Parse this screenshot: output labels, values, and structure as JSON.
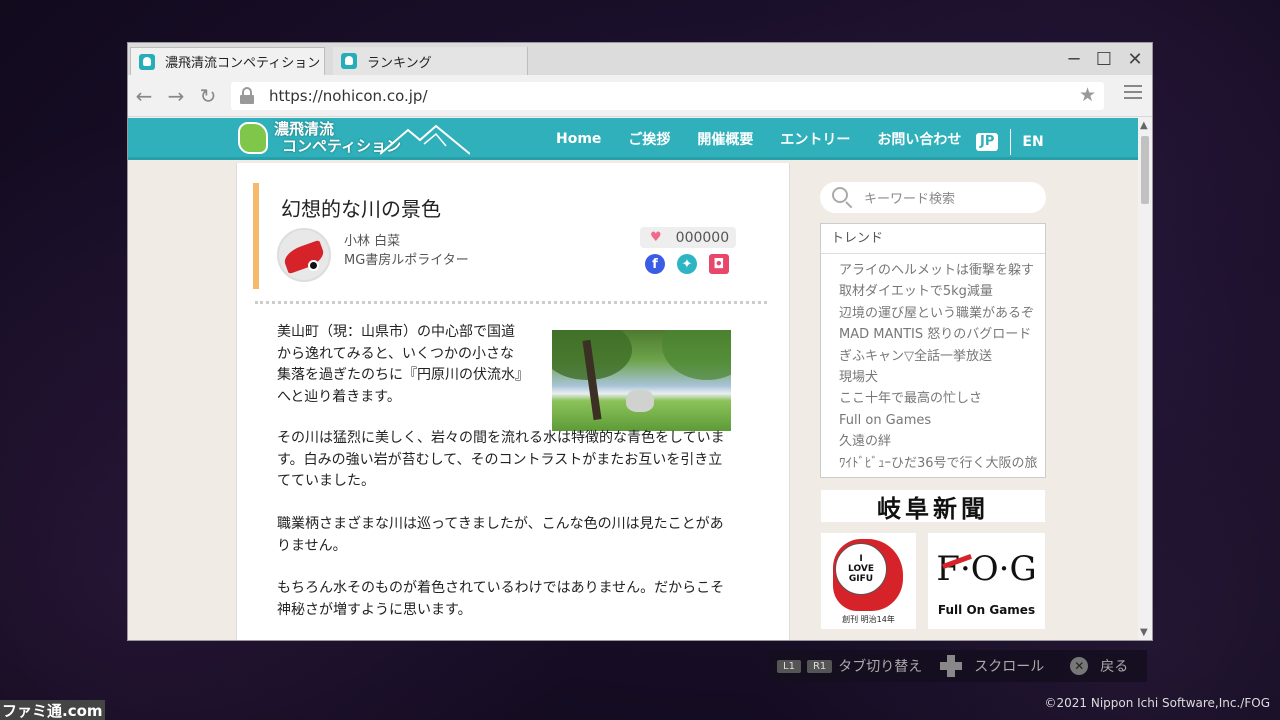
{
  "browser": {
    "tabs": [
      {
        "label": "濃飛清流コンペティション",
        "active": true
      },
      {
        "label": "ランキング",
        "active": false
      }
    ],
    "window_controls": {
      "minimize": "─",
      "maximize": "☐",
      "close": "✕"
    },
    "url": "https://nohicon.co.jp/",
    "nav": {
      "back": "←",
      "forward": "→",
      "reload": "↻"
    }
  },
  "site": {
    "logo_line1": "濃飛清流",
    "logo_line2": "コンペティション",
    "nav": [
      "Home",
      "ご挨拶",
      "開催概要",
      "エントリー",
      "お問い合わせ"
    ],
    "lang_jp": "JP",
    "lang_en": "EN",
    "accent_color": "#2fb0ba"
  },
  "article": {
    "title": "幻想的な川の景色",
    "author_name": "小林 白菜",
    "author_role": "MG書房ルポライター",
    "likes": "000000",
    "paragraphs": [
      "美山町（現：山県市）の中心部で国道から逸れてみると、いくつかの小さな集落を過ぎたのちに『円原川の伏流水』へと辿り着きます。",
      "その川は猛烈に美しく、岩々の間を流れる水は特徴的な青色をしています。白みの強い岩が苔むして、そのコントラストがまたお互いを引き立てていました。",
      "職業柄さまざまな川は巡ってきましたが、こんな色の川は見たことがありません。",
      "もちろん水そのものが着色されているわけではありません。だからこそ神秘さが増すように思います。"
    ]
  },
  "sidebar": {
    "search_placeholder": "キーワード検索",
    "trend_title": "トレンド",
    "trends": [
      "アライのヘルメットは衝撃を躱す",
      "取材ダイエットで5kg減量",
      "辺境の運び屋という職業があるぞ",
      "MAD MANTIS 怒りのバグロード",
      "ぎふキャン▽全話一挙放送",
      "現場犬",
      "ここ十年で最高の忙しさ",
      "Full on Games",
      "久遠の絆",
      "ﾜｲﾄﾞﾋﾞｭｰひだ36号で行く大阪の旅"
    ],
    "ad_newspaper": "岐阜新聞",
    "ad_love_lines": [
      "I",
      "LOVE",
      "GIFU"
    ],
    "ad_love_caption": "創刊 明治14年",
    "ad_fog_logo": "F·O·G",
    "ad_fog_tag": "Full On Games"
  },
  "controls": {
    "l1": "L1",
    "r1": "R1",
    "tab_switch": "タブ切り替え",
    "scroll": "スクロール",
    "back_symbol": "✕",
    "back": "戻る"
  },
  "copyright": "©2021 Nippon Ichi Software,Inc./FOG",
  "watermark": "ファミ通.com"
}
